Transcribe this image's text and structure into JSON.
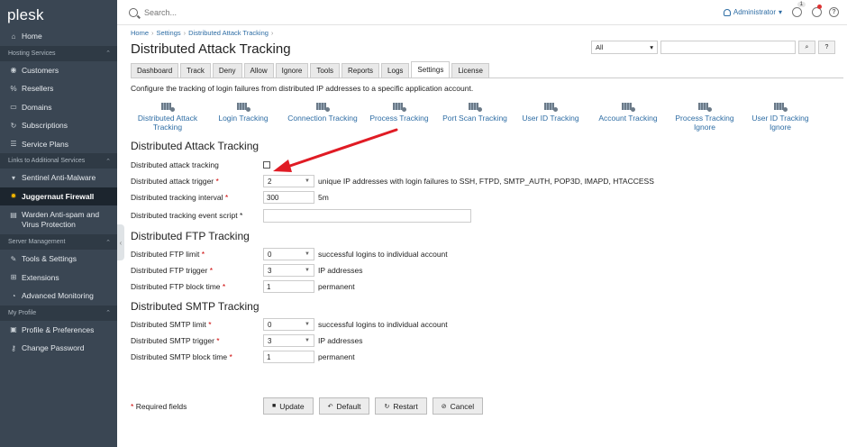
{
  "app": {
    "logo": "plesk"
  },
  "topbar": {
    "search_placeholder": "Search...",
    "user": "Administrator",
    "notifications": "1"
  },
  "sidebar": {
    "items_top": [
      {
        "label": "Home",
        "icon": "home-icon"
      }
    ],
    "sections": [
      {
        "title": "Hosting Services",
        "items": [
          {
            "label": "Customers",
            "icon": "person-icon"
          },
          {
            "label": "Resellers",
            "icon": "percent-icon"
          },
          {
            "label": "Domains",
            "icon": "monitor-icon"
          },
          {
            "label": "Subscriptions",
            "icon": "refresh-icon"
          },
          {
            "label": "Service Plans",
            "icon": "list-icon"
          }
        ]
      },
      {
        "title": "Links to Additional Services",
        "items": [
          {
            "label": "Sentinel Anti-Malware",
            "icon": "shield-icon"
          },
          {
            "label": "Juggernaut Firewall",
            "icon": "gear-icon",
            "active": true
          },
          {
            "label": "Warden Anti-spam and Virus Protection",
            "icon": "warden-icon"
          }
        ]
      },
      {
        "title": "Server Management",
        "items": [
          {
            "label": "Tools & Settings",
            "icon": "tools-icon"
          },
          {
            "label": "Extensions",
            "icon": "extensions-icon"
          },
          {
            "label": "Advanced Monitoring",
            "icon": "monitoring-icon"
          }
        ]
      },
      {
        "title": "My Profile",
        "items": [
          {
            "label": "Profile & Preferences",
            "icon": "profile-icon"
          },
          {
            "label": "Change Password",
            "icon": "key-icon"
          }
        ]
      }
    ]
  },
  "breadcrumb": [
    "Home",
    "Settings",
    "Distributed Attack Tracking"
  ],
  "page_title": "Distributed Attack Tracking",
  "filter": {
    "select": "All"
  },
  "tabs": [
    "Dashboard",
    "Track",
    "Deny",
    "Allow",
    "Ignore",
    "Tools",
    "Reports",
    "Logs",
    "Settings",
    "License"
  ],
  "active_tab": "Settings",
  "intro": "Configure the tracking of login failures from distributed IP addresses to a specific application account.",
  "settings_links": [
    {
      "l1": "Distributed Attack",
      "l2": "Tracking"
    },
    {
      "l1": "Login Tracking",
      "l2": ""
    },
    {
      "l1": "Connection Tracking",
      "l2": ""
    },
    {
      "l1": "Process Tracking",
      "l2": ""
    },
    {
      "l1": "Port Scan Tracking",
      "l2": ""
    },
    {
      "l1": "User ID Tracking",
      "l2": ""
    },
    {
      "l1": "Account Tracking",
      "l2": ""
    },
    {
      "l1": "Process Tracking",
      "l2": "Ignore"
    },
    {
      "l1": "User ID Tracking",
      "l2": "Ignore"
    }
  ],
  "sections": {
    "attack": {
      "title": "Distributed Attack Tracking",
      "tracking_label": "Distributed attack tracking",
      "trigger_label": "Distributed attack trigger",
      "trigger_value": "2",
      "trigger_suffix": "unique IP addresses with login failures to SSH, FTPD, SMTP_AUTH, POP3D, IMAPD, HTACCESS",
      "interval_label": "Distributed tracking interval",
      "interval_value": "300",
      "interval_suffix": "5m",
      "script_label": "Distributed tracking event script",
      "script_value": ""
    },
    "ftp": {
      "title": "Distributed FTP Tracking",
      "limit_label": "Distributed FTP limit",
      "limit_value": "0",
      "limit_suffix": "successful logins to individual account",
      "trigger_label": "Distributed FTP trigger",
      "trigger_value": "3",
      "trigger_suffix": "IP addresses",
      "block_label": "Distributed FTP block time",
      "block_value": "1",
      "block_suffix": "permanent"
    },
    "smtp": {
      "title": "Distributed SMTP Tracking",
      "limit_label": "Distributed SMTP limit",
      "limit_value": "0",
      "limit_suffix": "successful logins to individual account",
      "trigger_label": "Distributed SMTP trigger",
      "trigger_value": "3",
      "trigger_suffix": "IP addresses",
      "block_label": "Distributed SMTP block time",
      "block_value": "1",
      "block_suffix": "permanent"
    }
  },
  "required_star": "*",
  "footer": {
    "required_note": "Required fields",
    "update": "Update",
    "default": "Default",
    "restart": "Restart",
    "cancel": "Cancel"
  },
  "colors": {
    "sidebar": "#3a4653",
    "active_item": "#1c252e",
    "link": "#2e6da4",
    "arrow": "#e01b24"
  }
}
